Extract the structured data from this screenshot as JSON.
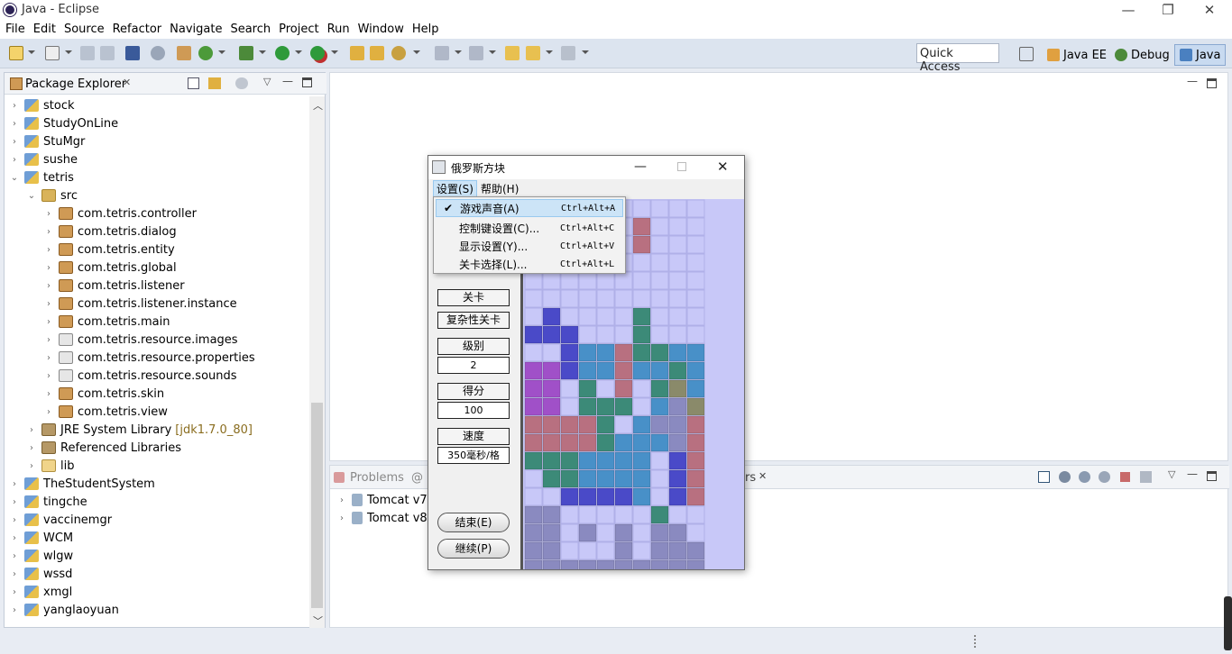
{
  "window": {
    "title": "Java - Eclipse",
    "minimize": "—",
    "restore": "❐",
    "close": "✕"
  },
  "menubar": [
    "File",
    "Edit",
    "Source",
    "Refactor",
    "Navigate",
    "Search",
    "Project",
    "Run",
    "Window",
    "Help"
  ],
  "quick_access": "Quick Access",
  "perspectives": [
    {
      "label": "Java EE",
      "icon": "javaee-perspective-icon"
    },
    {
      "label": "Debug",
      "icon": "debug-perspective-icon"
    },
    {
      "label": "Java",
      "icon": "java-perspective-icon",
      "active": true
    }
  ],
  "package_explorer": {
    "title": "Package Explorer",
    "items": [
      {
        "label": "stock",
        "level": 0,
        "icon": "project",
        "arrow": "›"
      },
      {
        "label": "StudyOnLine",
        "level": 0,
        "icon": "project",
        "arrow": "›"
      },
      {
        "label": "StuMgr",
        "level": 0,
        "icon": "project",
        "arrow": "›"
      },
      {
        "label": "sushe",
        "level": 0,
        "icon": "project",
        "arrow": "›"
      },
      {
        "label": "tetris",
        "level": 0,
        "icon": "project",
        "arrow": "⌄"
      },
      {
        "label": "src",
        "level": 1,
        "icon": "src",
        "arrow": "⌄"
      },
      {
        "label": "com.tetris.controller",
        "level": 2,
        "icon": "pkg",
        "arrow": "›"
      },
      {
        "label": "com.tetris.dialog",
        "level": 2,
        "icon": "pkg",
        "arrow": "›"
      },
      {
        "label": "com.tetris.entity",
        "level": 2,
        "icon": "pkg",
        "arrow": "›"
      },
      {
        "label": "com.tetris.global",
        "level": 2,
        "icon": "pkg",
        "arrow": "›"
      },
      {
        "label": "com.tetris.listener",
        "level": 2,
        "icon": "pkg",
        "arrow": "›"
      },
      {
        "label": "com.tetris.listener.instance",
        "level": 2,
        "icon": "pkg",
        "arrow": "›"
      },
      {
        "label": "com.tetris.main",
        "level": 2,
        "icon": "pkg",
        "arrow": "›"
      },
      {
        "label": "com.tetris.resource.images",
        "level": 2,
        "icon": "pkgg",
        "arrow": "›"
      },
      {
        "label": "com.tetris.resource.properties",
        "level": 2,
        "icon": "pkgg",
        "arrow": "›"
      },
      {
        "label": "com.tetris.resource.sounds",
        "level": 2,
        "icon": "pkgg",
        "arrow": "›"
      },
      {
        "label": "com.tetris.skin",
        "level": 2,
        "icon": "pkg",
        "arrow": "›"
      },
      {
        "label": "com.tetris.view",
        "level": 2,
        "icon": "pkg",
        "arrow": "›"
      },
      {
        "label": "JRE System Library",
        "decoration": "[jdk1.7.0_80]",
        "level": 1,
        "icon": "lib",
        "arrow": "›"
      },
      {
        "label": "Referenced Libraries",
        "level": 1,
        "icon": "lib",
        "arrow": "›"
      },
      {
        "label": "lib",
        "level": 1,
        "icon": "fold",
        "arrow": "›"
      },
      {
        "label": "TheStudentSystem",
        "level": 0,
        "icon": "project",
        "arrow": "›"
      },
      {
        "label": "tingche",
        "level": 0,
        "icon": "project",
        "arrow": "›"
      },
      {
        "label": "vaccinemgr",
        "level": 0,
        "icon": "project",
        "arrow": "›"
      },
      {
        "label": "WCM",
        "level": 0,
        "icon": "project",
        "arrow": "›"
      },
      {
        "label": "wlgw",
        "level": 0,
        "icon": "project",
        "arrow": "›"
      },
      {
        "label": "wssd",
        "level": 0,
        "icon": "project",
        "arrow": "›"
      },
      {
        "label": "xmgl",
        "level": 0,
        "icon": "project",
        "arrow": "›"
      },
      {
        "label": "yanglaoyuan",
        "level": 0,
        "icon": "project",
        "arrow": "›"
      }
    ]
  },
  "bottom_panel": {
    "tab_problems": "Problems",
    "tab_at": "@",
    "tab_servers_tail": "rs",
    "servers": [
      "Tomcat v7.",
      "Tomcat v8."
    ]
  },
  "game": {
    "title": "俄罗斯方块",
    "menu": [
      "设置(S)",
      "帮助(H)"
    ],
    "dropdown": [
      {
        "label": "游戏声音(A)",
        "shortcut": "Ctrl+Alt+A",
        "checked": true
      },
      {
        "label": "控制键设置(C)...",
        "shortcut": "Ctrl+Alt+C",
        "checked": false
      },
      {
        "label": "显示设置(Y)...",
        "shortcut": "Ctrl+Alt+V",
        "checked": false
      },
      {
        "label": "关卡选择(L)...",
        "shortcut": "Ctrl+Alt+L",
        "checked": false
      }
    ],
    "btn_level": "关卡",
    "btn_complex": "复杂性关卡",
    "label_rank": "级别",
    "value_rank": "2",
    "label_score": "得分",
    "value_score": "100",
    "label_speed": "速度",
    "value_speed": "350毫秒/格",
    "btn_end": "结束(E)",
    "btn_continue": "继续(P)",
    "colors": {
      "empty": "#c8c8f8",
      "blue": "#4a4ac8",
      "teal": "#3c8a78",
      "sky": "#4890c8",
      "purple": "#a050c8",
      "rose": "#b87080",
      "olive": "#8a8a6a",
      "plum": "#8a3a7a",
      "grey": "#8a8ac0"
    },
    "grid": [
      "..........",
      "......r...",
      "......r...",
      "..........",
      "..........",
      "..........",
      ".B....T...",
      "BBB...T...",
      "..BSSrTTSS",
      "PPBSSrSSTS",
      "PP.T.r.ToS",
      "PP.TTT.SqO",
      "rrrrT.Sqqr",
      "rrrrTSSSqr",
      "TTTSSSS.BR",
      ".TTSSSS.BR",
      "..BBBBS.BR",
      "qq.....T..",
      "qq.g.g.gg.",
      "gg...g.ggg",
      "gggggggggg"
    ]
  }
}
